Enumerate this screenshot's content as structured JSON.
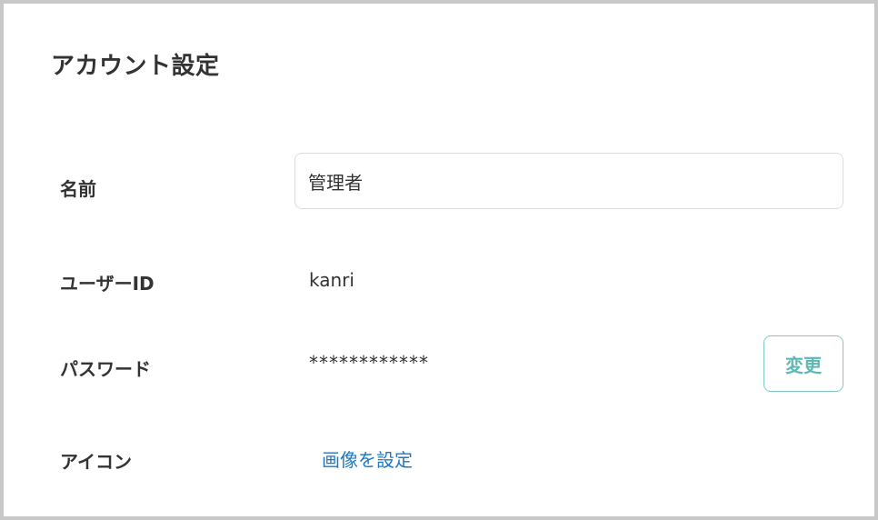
{
  "page": {
    "title": "アカウント設定"
  },
  "fields": {
    "name": {
      "label": "名前",
      "value": "管理者"
    },
    "user_id": {
      "label": "ユーザーID",
      "value": "kanri"
    },
    "password": {
      "label": "パスワード",
      "value": "************",
      "change_label": "変更"
    },
    "icon": {
      "label": "アイコン",
      "action_label": "画像を設定"
    }
  },
  "colors": {
    "border_frame": "#c8c8c8",
    "text": "#333333",
    "accent_teal": "#5db8b2",
    "link_blue": "#1f78c1"
  }
}
